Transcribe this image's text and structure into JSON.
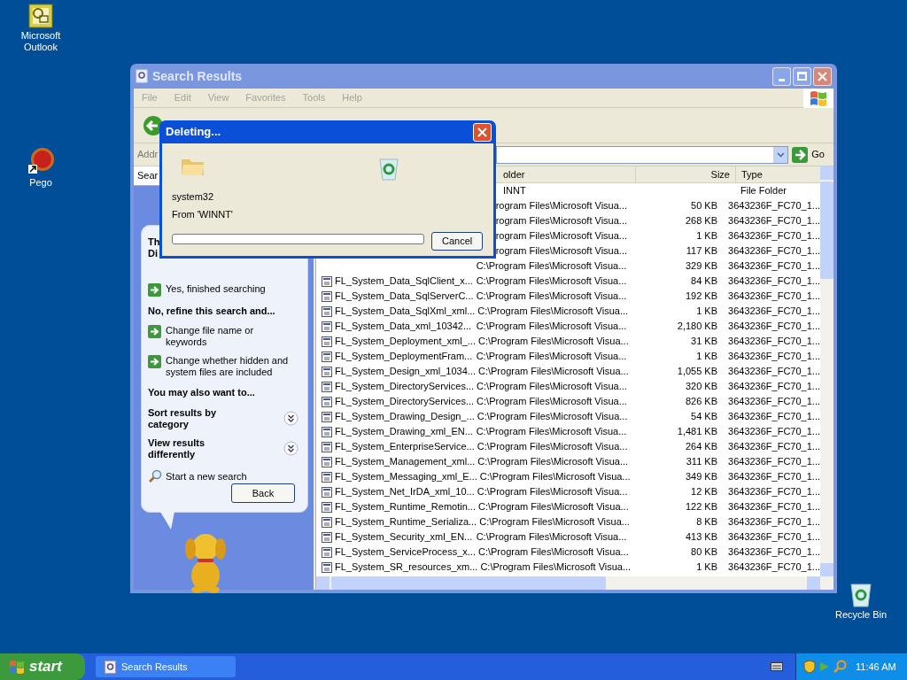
{
  "desktop_icons": [
    {
      "kind": "outlook",
      "label": "Microsoft Outlook"
    },
    {
      "kind": "shortcut",
      "label": "Pego"
    },
    {
      "kind": "recycle",
      "label": "Recycle Bin"
    }
  ],
  "window": {
    "title": "Search Results",
    "menu": [
      "File",
      "Edit",
      "View",
      "Favorites",
      "Tools",
      "Help"
    ],
    "address_label": "Addr",
    "go_button": "Go",
    "companion_tab": "Sear"
  },
  "companion": {
    "question": [
      "Th",
      "Di"
    ],
    "items": [
      {
        "kind": "link",
        "text": "Yes, finished searching"
      },
      {
        "kind": "heading",
        "text": "No, refine this search and..."
      },
      {
        "kind": "link",
        "text": "Change file name or keywords"
      },
      {
        "kind": "link",
        "text": "Change whether hidden and system files are included"
      },
      {
        "kind": "heading",
        "text": "You may also want to..."
      },
      {
        "kind": "expander",
        "text": "Sort results by category"
      },
      {
        "kind": "expander",
        "text": "View results differently"
      },
      {
        "kind": "search",
        "text": "Start a new search"
      }
    ],
    "back_button": "Back"
  },
  "table": {
    "columns": [
      "older",
      "Size",
      "Type"
    ],
    "rows": [
      {
        "folder": "INNT",
        "size": "",
        "type": "File Folder"
      },
      {
        "folder": "rogram Files\\Microsoft Visua...",
        "size": "50 KB",
        "type": "3643236F_FC70_1..."
      },
      {
        "folder": "rogram Files\\Microsoft Visua...",
        "size": "268 KB",
        "type": "3643236F_FC70_1..."
      },
      {
        "folder": "rogram Files\\Microsoft Visua...",
        "size": "1 KB",
        "type": "3643236F_FC70_1..."
      },
      {
        "folder": "rogram Files\\Microsoft Visua...",
        "size": "117 KB",
        "type": "3643236F_FC70_1..."
      },
      {
        "folder": "C:\\Program Files\\Microsoft Visua...",
        "size": "329 KB",
        "type": "3643236F_FC70_1..."
      },
      {
        "name": "FL_System_Data_SqlClient_x...",
        "folder": "C:\\Program Files\\Microsoft Visua...",
        "size": "84 KB",
        "type": "3643236F_FC70_1..."
      },
      {
        "name": "FL_System_Data_SqlServerC...",
        "folder": "C:\\Program Files\\Microsoft Visua...",
        "size": "192 KB",
        "type": "3643236F_FC70_1..."
      },
      {
        "name": "FL_System_Data_SqlXml_xml...",
        "folder": "C:\\Program Files\\Microsoft Visua...",
        "size": "1 KB",
        "type": "3643236F_FC70_1..."
      },
      {
        "name": "FL_System_Data_xml_10342...",
        "folder": "C:\\Program Files\\Microsoft Visua...",
        "size": "2,180 KB",
        "type": "3643236F_FC70_1..."
      },
      {
        "name": "FL_System_Deployment_xml_...",
        "folder": "C:\\Program Files\\Microsoft Visua...",
        "size": "31 KB",
        "type": "3643236F_FC70_1..."
      },
      {
        "name": "FL_System_DeploymentFram...",
        "folder": "C:\\Program Files\\Microsoft Visua...",
        "size": "1 KB",
        "type": "3643236F_FC70_1..."
      },
      {
        "name": "FL_System_Design_xml_1034...",
        "folder": "C:\\Program Files\\Microsoft Visua...",
        "size": "1,055 KB",
        "type": "3643236F_FC70_1..."
      },
      {
        "name": "FL_System_DirectoryServices...",
        "folder": "C:\\Program Files\\Microsoft Visua...",
        "size": "320 KB",
        "type": "3643236F_FC70_1..."
      },
      {
        "name": "FL_System_DirectoryServices...",
        "folder": "C:\\Program Files\\Microsoft Visua...",
        "size": "826 KB",
        "type": "3643236F_FC70_1..."
      },
      {
        "name": "FL_System_Drawing_Design_...",
        "folder": "C:\\Program Files\\Microsoft Visua...",
        "size": "54 KB",
        "type": "3643236F_FC70_1..."
      },
      {
        "name": "FL_System_Drawing_xml_EN...",
        "folder": "C:\\Program Files\\Microsoft Visua...",
        "size": "1,481 KB",
        "type": "3643236F_FC70_1..."
      },
      {
        "name": "FL_System_EnterpriseService...",
        "folder": "C:\\Program Files\\Microsoft Visua...",
        "size": "264 KB",
        "type": "3643236F_FC70_1..."
      },
      {
        "name": "FL_System_Management_xml...",
        "folder": "C:\\Program Files\\Microsoft Visua...",
        "size": "311 KB",
        "type": "3643236F_FC70_1..."
      },
      {
        "name": "FL_System_Messaging_xml_E...",
        "folder": "C:\\Program Files\\Microsoft Visua...",
        "size": "349 KB",
        "type": "3643236F_FC70_1..."
      },
      {
        "name": "FL_System_Net_IrDA_xml_10...",
        "folder": "C:\\Program Files\\Microsoft Visua...",
        "size": "12 KB",
        "type": "3643236F_FC70_1..."
      },
      {
        "name": "FL_System_Runtime_Remotin...",
        "folder": "C:\\Program Files\\Microsoft Visua...",
        "size": "122 KB",
        "type": "3643236F_FC70_1..."
      },
      {
        "name": "FL_System_Runtime_Serializa...",
        "folder": "C:\\Program Files\\Microsoft Visua...",
        "size": "8 KB",
        "type": "3643236F_FC70_1..."
      },
      {
        "name": "FL_System_Security_xml_EN...",
        "folder": "C:\\Program Files\\Microsoft Visua...",
        "size": "413 KB",
        "type": "3643236F_FC70_1..."
      },
      {
        "name": "FL_System_ServiceProcess_x...",
        "folder": "C:\\Program Files\\Microsoft Visua...",
        "size": "80 KB",
        "type": "3643236F_FC70_1..."
      },
      {
        "name": "FL_System_SR_resources_xm...",
        "folder": "C:\\Program Files\\Microsoft Visua...",
        "size": "1 KB",
        "type": "3643236F_FC70_1..."
      }
    ]
  },
  "dialog": {
    "title": "Deleting...",
    "file": "system32",
    "source": "From 'WINNT'",
    "level": 0,
    "cancel_button": "Cancel"
  },
  "taskbar": {
    "start": "start",
    "tasks": [
      "Search Results"
    ],
    "clock": "11:46 AM"
  }
}
